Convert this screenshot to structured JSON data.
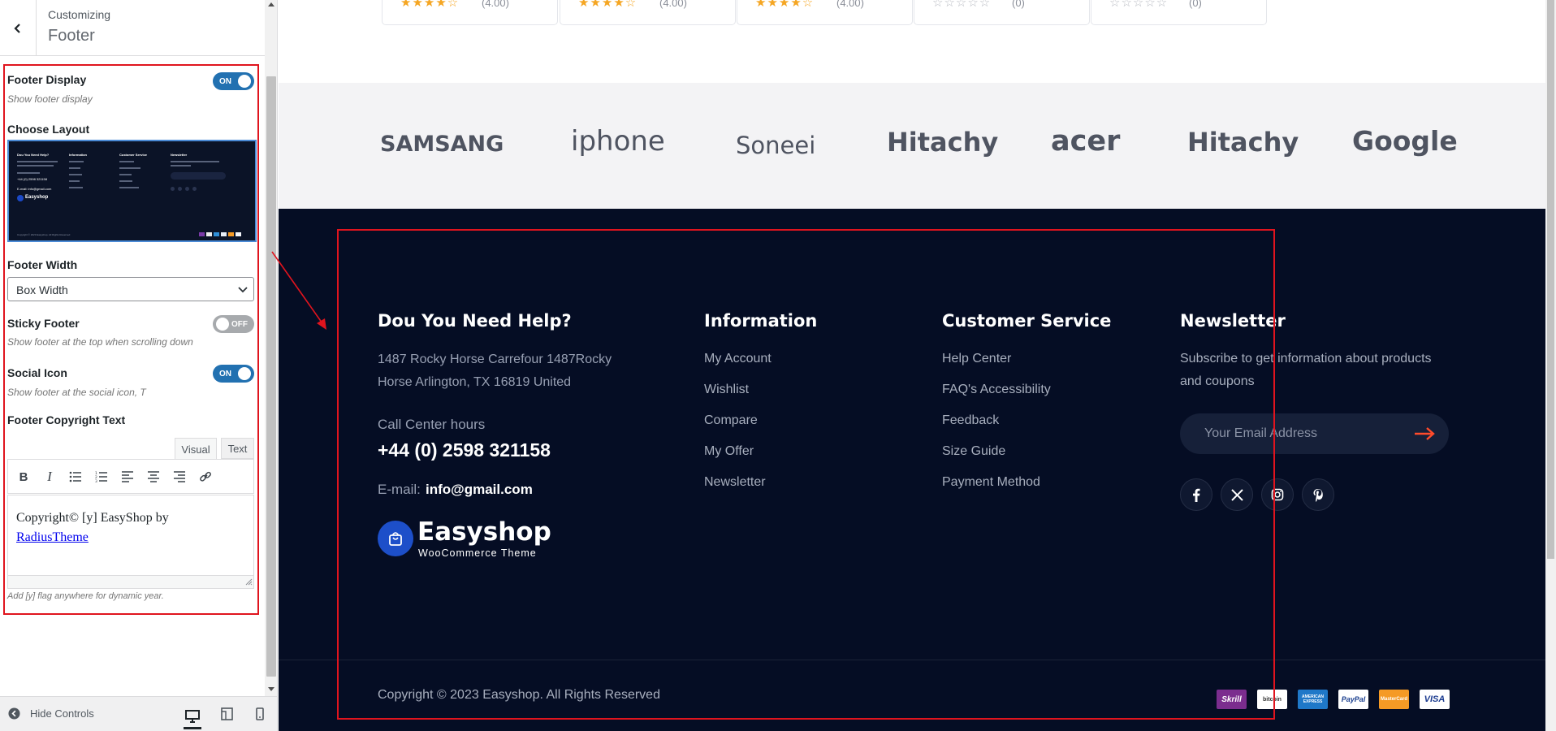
{
  "customizer": {
    "breadcrumb": "Customizing",
    "section": "Footer",
    "controls": {
      "footer_display": {
        "label": "Footer Display",
        "desc": "Show footer display",
        "state": "ON"
      },
      "choose_layout": {
        "label": "Choose Layout"
      },
      "footer_width": {
        "label": "Footer Width",
        "value": "Box Width"
      },
      "sticky_footer": {
        "label": "Sticky Footer",
        "desc": "Show footer at the top when scrolling down",
        "state": "OFF"
      },
      "social_icon": {
        "label": "Social Icon",
        "desc": "Show footer at the social icon, T",
        "state": "ON"
      },
      "copyright": {
        "label": "Footer Copyright Text",
        "tab_visual": "Visual",
        "tab_text": "Text",
        "content_prefix": "Copyright© [y] EasyShop by",
        "content_link": "RadiusTheme",
        "help": "Add [y] flag anywhere for dynamic year."
      }
    },
    "footer_bar": {
      "hide_controls": "Hide Controls"
    }
  },
  "layout_preview": {
    "col1_title": "Dou You Need Help?",
    "col2_title": "Information",
    "col3_title": "Customer Service",
    "col4_title": "Newsletter",
    "phone": "+44 (0) 2598 321158",
    "email": "E-mail: info@gmail.com",
    "brand": "Easyshop",
    "copyright": "Copyright © 2023 Easyshop. All Rights Reserved"
  },
  "products": [
    {
      "stars": "★★★★☆",
      "rating": "(4.00)"
    },
    {
      "stars": "★★★★☆",
      "rating": "(4.00)"
    },
    {
      "stars": "★★★★☆",
      "rating": "(4.00)"
    },
    {
      "stars": "☆☆☆☆☆",
      "rating": "(0)"
    },
    {
      "stars": "☆☆☆☆☆",
      "rating": "(0)"
    }
  ],
  "brands": [
    "SAMSANG",
    "iphone",
    "Soneei",
    "Hitachy",
    "acer",
    "Hitachy",
    "Google"
  ],
  "footer": {
    "help": {
      "title": "Dou You Need Help?",
      "address_line1": "1487 Rocky Horse Carrefour 1487Rocky",
      "address_line2": "Horse Arlington, TX 16819 United",
      "call_label": "Call Center hours",
      "phone": "+44 (0) 2598 321158",
      "email_label": "E-mail:",
      "email": "info@gmail.com"
    },
    "logo": {
      "name": "Easyshop",
      "tagline": "WooCommerce Theme"
    },
    "information": {
      "title": "Information",
      "links": [
        "My Account",
        "Wishlist",
        "Compare",
        "My Offer",
        "Newsletter"
      ]
    },
    "customer_service": {
      "title": "Customer Service",
      "links": [
        "Help Center",
        "FAQ's Accessibility",
        "Feedback",
        "Size Guide",
        "Payment Method"
      ]
    },
    "newsletter": {
      "title": "Newsletter",
      "text_line1": "Subscribe to get information about products",
      "text_line2": "and coupons",
      "placeholder": "Your Email Address"
    },
    "social": [
      "facebook-icon",
      "x-twitter-icon",
      "instagram-icon",
      "pinterest-icon"
    ],
    "copyright": "Copyright © 2023 Easyshop. All Rights Reserved",
    "payments": [
      "Skrill",
      "bitcoin",
      "AMERICAN EXPRESS",
      "PayPal",
      "MasterCard",
      "VISA"
    ]
  },
  "colors": {
    "annotation_red": "#e0141e",
    "toggle_on": "#2271b1",
    "footer_bg": "#050d24",
    "brands_bg": "#f3f3f5",
    "accent_arrow": "#ff4b2b"
  }
}
